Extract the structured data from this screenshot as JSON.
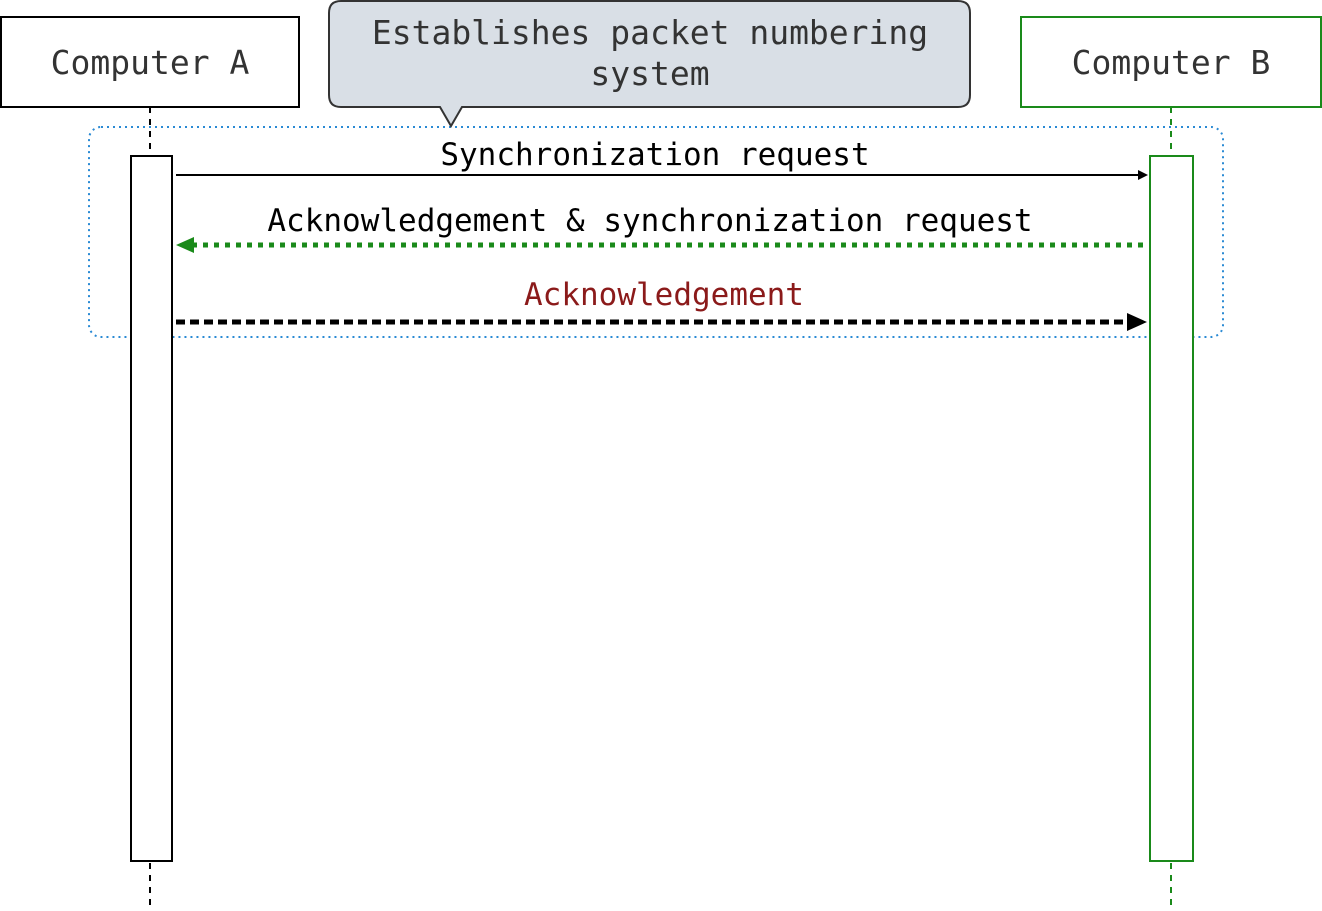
{
  "participants": {
    "a": {
      "label": "Computer A",
      "color": "#000000",
      "text_color": "#333333"
    },
    "b": {
      "label": "Computer B",
      "color": "#1a8a1a",
      "text_color": "#333333"
    }
  },
  "group_box": {
    "color": "#2a8ad4",
    "style": "dotted"
  },
  "note": {
    "lines": [
      "Establishes packet numbering",
      "system"
    ],
    "fill": "#d9dfe6",
    "border": "#333333",
    "text_color": "#333333"
  },
  "messages": [
    {
      "label": "Synchronization request",
      "direction": "A→B",
      "style": "solid",
      "color": "#000000",
      "label_color": "#000000"
    },
    {
      "label": "Acknowledgement & synchronization request",
      "direction": "B→A",
      "style": "dotted",
      "color": "#1a8a1a",
      "label_color": "#000000"
    },
    {
      "label": "Acknowledgement",
      "direction": "A→B",
      "style": "dashed",
      "color": "#000000",
      "label_color": "#8b1a1a"
    }
  ]
}
